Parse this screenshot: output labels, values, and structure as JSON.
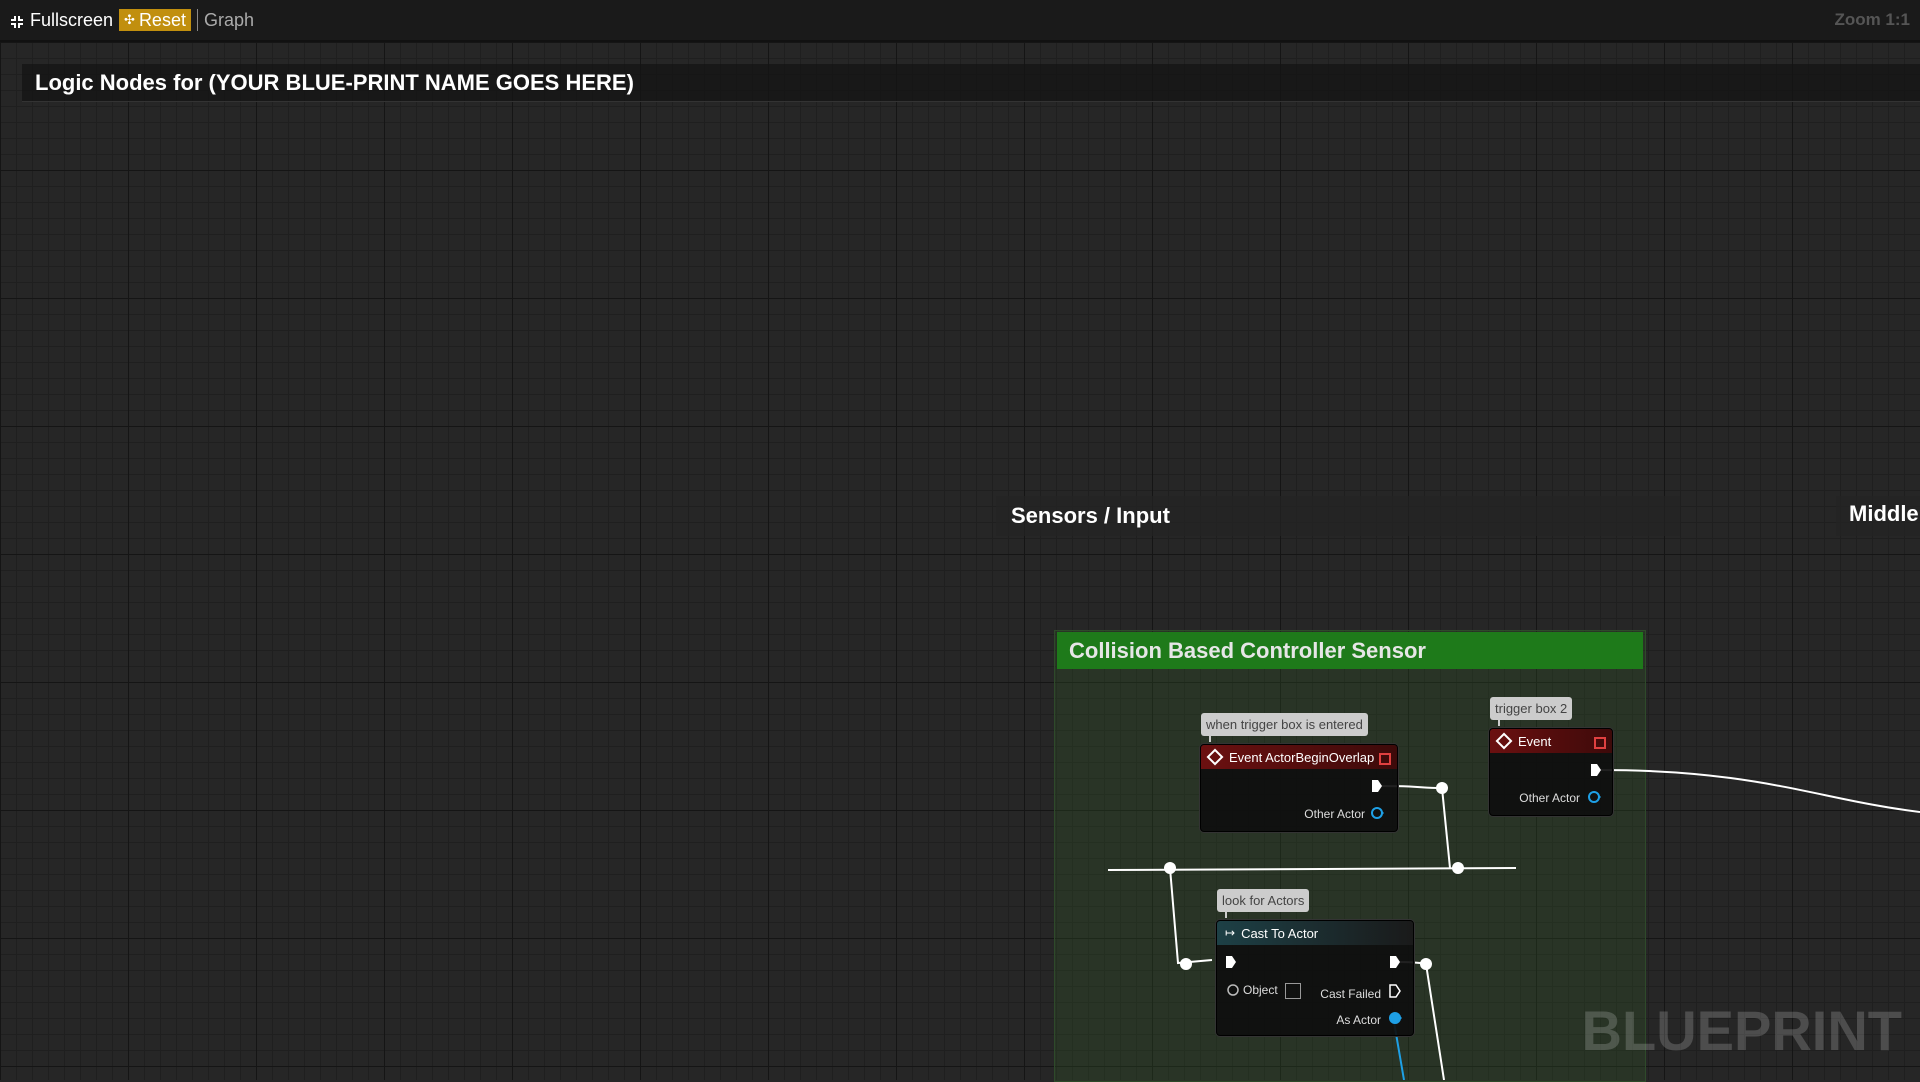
{
  "toolbar": {
    "fullscreen_label": "Fullscreen",
    "reset_label": "Reset",
    "graph_label": "Graph",
    "zoom_label": "Zoom 1:1"
  },
  "comments": {
    "main_title": "Logic Nodes for (YOUR BLUE-PRINT NAME GOES HERE)",
    "sensors_title": "Sensors / Input",
    "middle_title": "Middle"
  },
  "group": {
    "title": "Collision Based Controller Sensor"
  },
  "nodes": {
    "event_overlap": {
      "tooltip": "when trigger box is entered",
      "title": "Event ActorBeginOverlap",
      "output_label": "Other Actor"
    },
    "event_trigger2": {
      "tooltip": "trigger box 2",
      "title": "Event",
      "output_label": "Other Actor"
    },
    "cast_to_actor": {
      "tooltip": "look for Actors",
      "title": "Cast To Actor",
      "object_label": "Object",
      "cast_failed_label": "Cast Failed",
      "as_actor_label": "As Actor"
    }
  },
  "watermark": "BLUEPRINT",
  "colors": {
    "reset_bg": "#c18f0e",
    "group_header": "#1e7a1a",
    "event_header": "#6b1010",
    "object_pin": "#1ea0e6"
  }
}
